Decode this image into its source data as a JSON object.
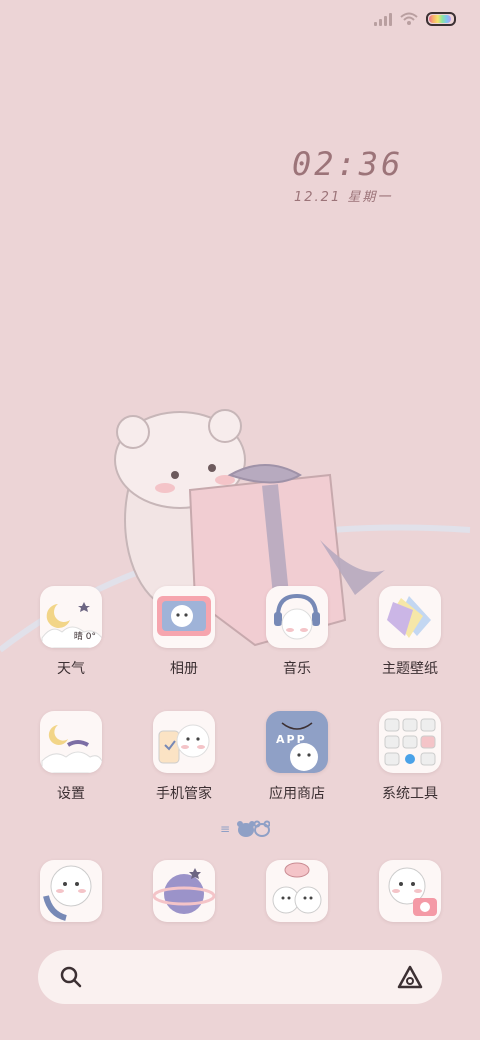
{
  "status_bar": {
    "signal_icon": "signal-icon",
    "wifi_icon": "wifi-icon",
    "battery_icon": "battery-icon"
  },
  "clock": {
    "time": "02:36",
    "date": "12.21 星期一"
  },
  "apps_row1": [
    {
      "label": "天气",
      "icon": "weather-icon",
      "badge": "晴 0°"
    },
    {
      "label": "相册",
      "icon": "gallery-icon"
    },
    {
      "label": "音乐",
      "icon": "music-icon"
    },
    {
      "label": "主题壁纸",
      "icon": "themes-icon"
    }
  ],
  "apps_row2": [
    {
      "label": "设置",
      "icon": "settings-icon"
    },
    {
      "label": "手机管家",
      "icon": "phone-manager-icon"
    },
    {
      "label": "应用商店",
      "icon": "app-store-icon",
      "badge": "APP"
    },
    {
      "label": "系统工具",
      "icon": "system-tools-icon"
    }
  ],
  "dock": [
    {
      "icon": "phone-icon"
    },
    {
      "icon": "browser-icon"
    },
    {
      "icon": "messages-icon"
    },
    {
      "icon": "camera-icon"
    }
  ],
  "search": {
    "left_icon": "search-icon",
    "right_icon": "assistant-icon"
  },
  "colors": {
    "background": "#ecd4d6",
    "accent": "#9c7479",
    "label": "#3c3033"
  }
}
